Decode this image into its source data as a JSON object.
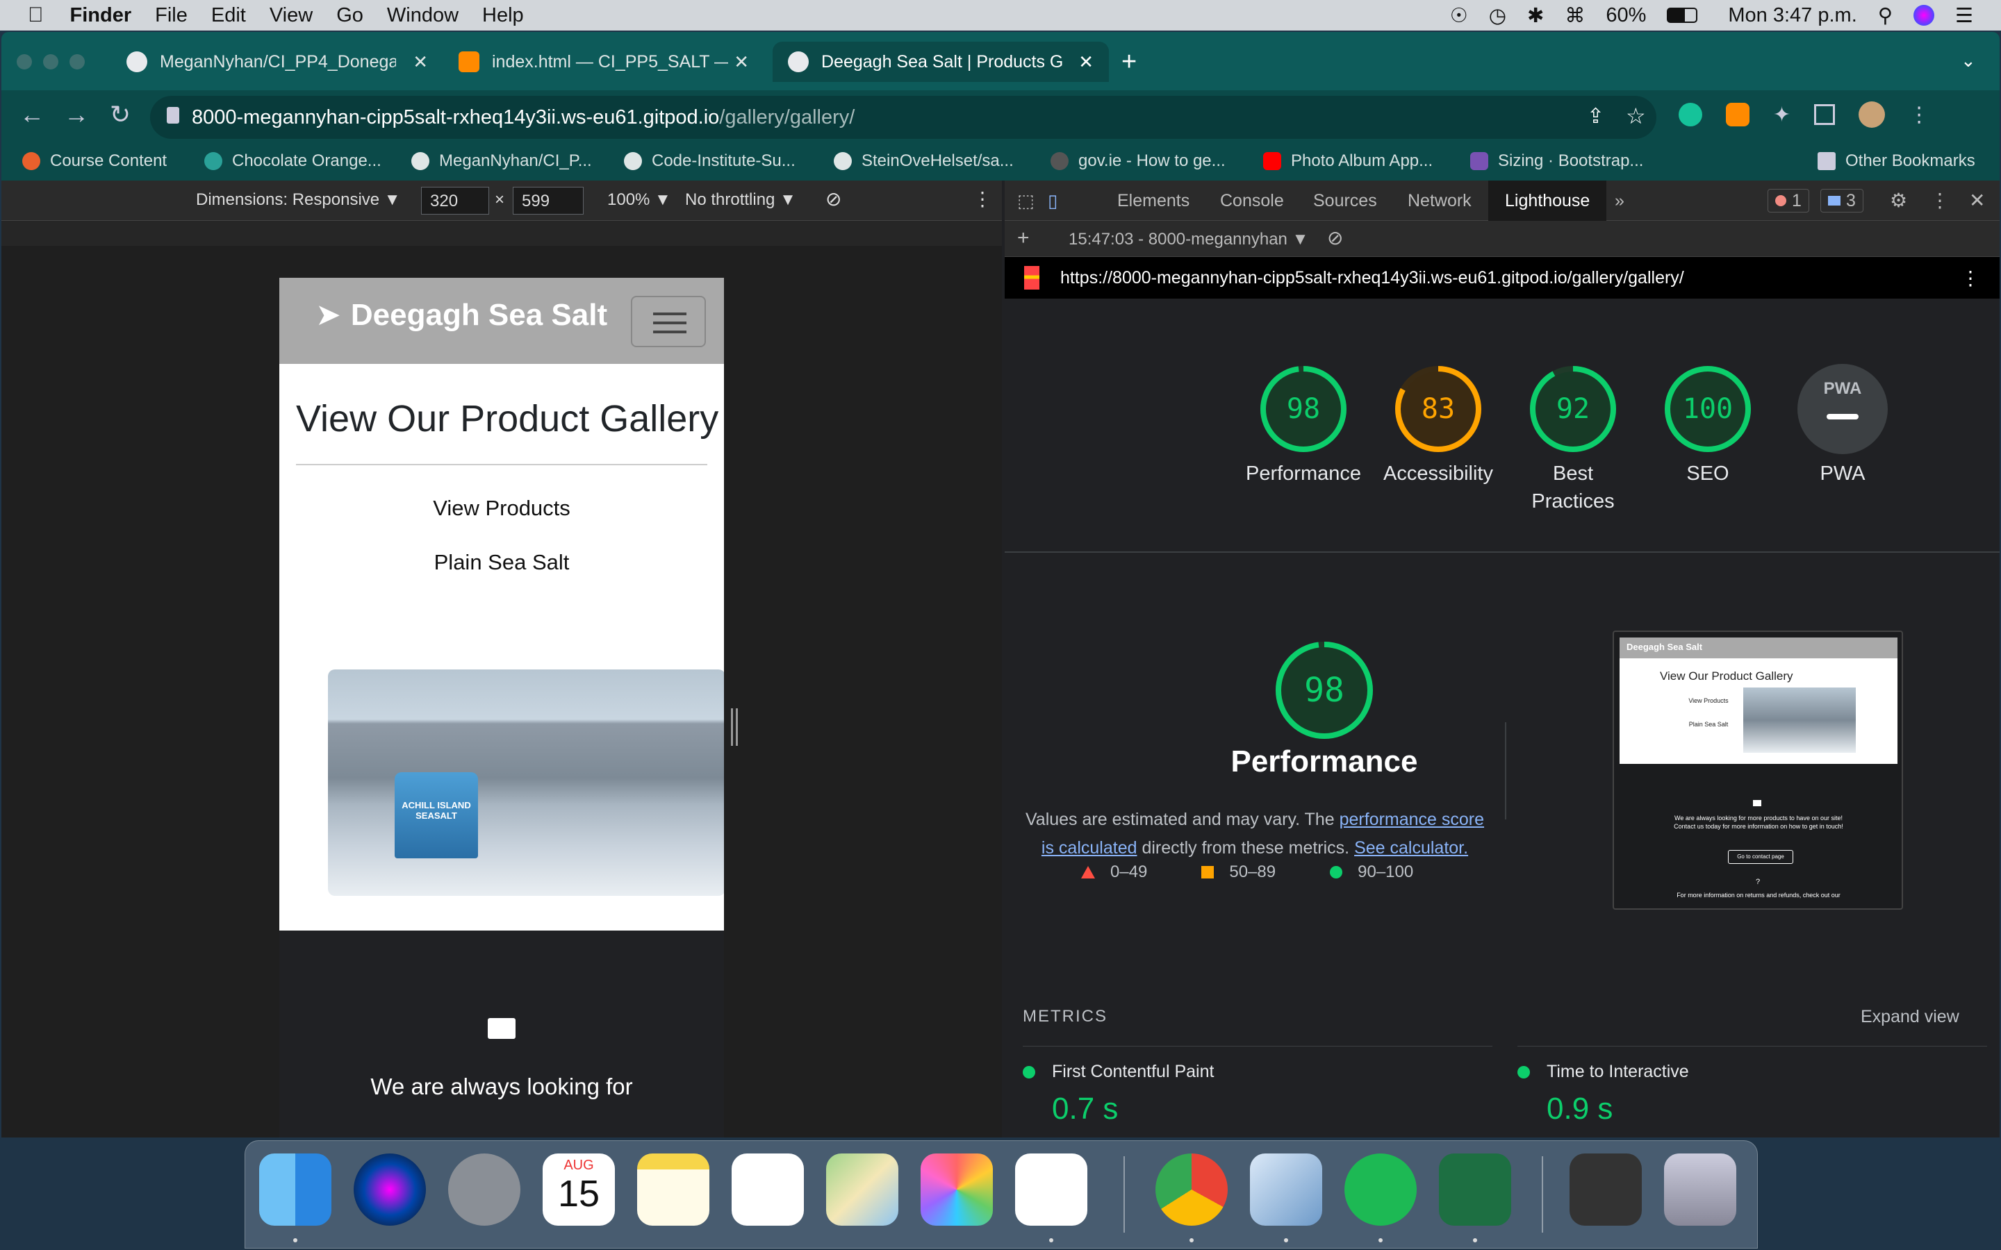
{
  "menubar": {
    "app": "Finder",
    "items": [
      "File",
      "Edit",
      "View",
      "Go",
      "Window",
      "Help"
    ],
    "battery": "60%",
    "clock": "Mon 3:47 p.m."
  },
  "browser": {
    "tabs": [
      {
        "title": "MeganNyhan/CI_PP4_Donegal_",
        "active": false
      },
      {
        "title": "index.html — CI_PP5_SALT — G",
        "active": false
      },
      {
        "title": "Deegagh Sea Salt | Products G",
        "active": true
      }
    ],
    "url_host": "8000-megannyhan-cipp5salt-rxheq14y3ii.ws-eu61.gitpod.io",
    "url_path": "/gallery/gallery/",
    "bookmarks": [
      "Course Content",
      "Chocolate Orange...",
      "MeganNyhan/CI_P...",
      "Code-Institute-Su...",
      "SteinOveHelset/sa...",
      "gov.ie - How to ge...",
      "Photo Album App...",
      "Sizing · Bootstrap..."
    ],
    "other_bookmarks": "Other Bookmarks"
  },
  "device_toolbar": {
    "dimensions_label": "Dimensions: Responsive ▼",
    "width": "320",
    "height": "599",
    "zoom": "100% ▼",
    "throttling": "No throttling ▼",
    "times": "×"
  },
  "site": {
    "brand": "Deegagh Sea Salt",
    "gallery_title": "View Our Product Gallery",
    "link_view_products": "View Products",
    "link_plain_salt": "Plain Sea Salt",
    "footer_text": "We are always looking for",
    "photo_jar_text": "ACHILL ISLAND SEASALT"
  },
  "devtools": {
    "tabs": [
      "Elements",
      "Console",
      "Sources",
      "Network",
      "Lighthouse"
    ],
    "active_tab": "Lighthouse",
    "more": "»",
    "errors": "1",
    "messages": "3",
    "report_label": "15:47:03 - 8000-megannyhan",
    "report_url": "https://8000-megannyhan-cipp5salt-rxheq14y3ii.ws-eu61.gitpod.io/gallery/gallery/"
  },
  "lighthouse": {
    "scores": [
      {
        "label": "Performance",
        "score": 98,
        "color": "#0cce6b"
      },
      {
        "label": "Accessibility",
        "score": 83,
        "color": "#ffa400"
      },
      {
        "label": "Best Practices",
        "score": 92,
        "color": "#0cce6b"
      },
      {
        "label": "SEO",
        "score": 100,
        "color": "#0cce6b"
      }
    ],
    "pwa_label": "PWA",
    "pwa_badge": "PWA",
    "big_score": "98",
    "big_title": "Performance",
    "desc_1": "Values are estimated and may vary. The ",
    "desc_link_1": "performance score is calculated",
    "desc_2": " directly from these metrics. ",
    "desc_link_2": "See calculator.",
    "legend": [
      "0–49",
      "50–89",
      "90–100"
    ],
    "metrics_heading": "METRICS",
    "expand_view": "Expand view",
    "metrics": [
      {
        "name": "First Contentful Paint",
        "value": "0.7 s"
      },
      {
        "name": "Time to Interactive",
        "value": "0.9 s"
      }
    ],
    "thumb": {
      "brand": "Deegagh Sea Salt",
      "title": "View Our Product Gallery",
      "link1": "View Products",
      "link2": "Plain Sea Salt",
      "footer1": "We are always looking for more products to have on our site! Contact us today for more information on how to get in touch!",
      "button": "Go to contact page",
      "q": "?",
      "footer2": "For more information on returns and refunds, check out our"
    }
  },
  "dock": {
    "calendar_month": "AUG",
    "calendar_day": "15"
  },
  "colors": {
    "good": "#0cce6b",
    "average": "#ffa400",
    "poor": "#ff4e42",
    "tabstrip": "#0d5b5a"
  }
}
